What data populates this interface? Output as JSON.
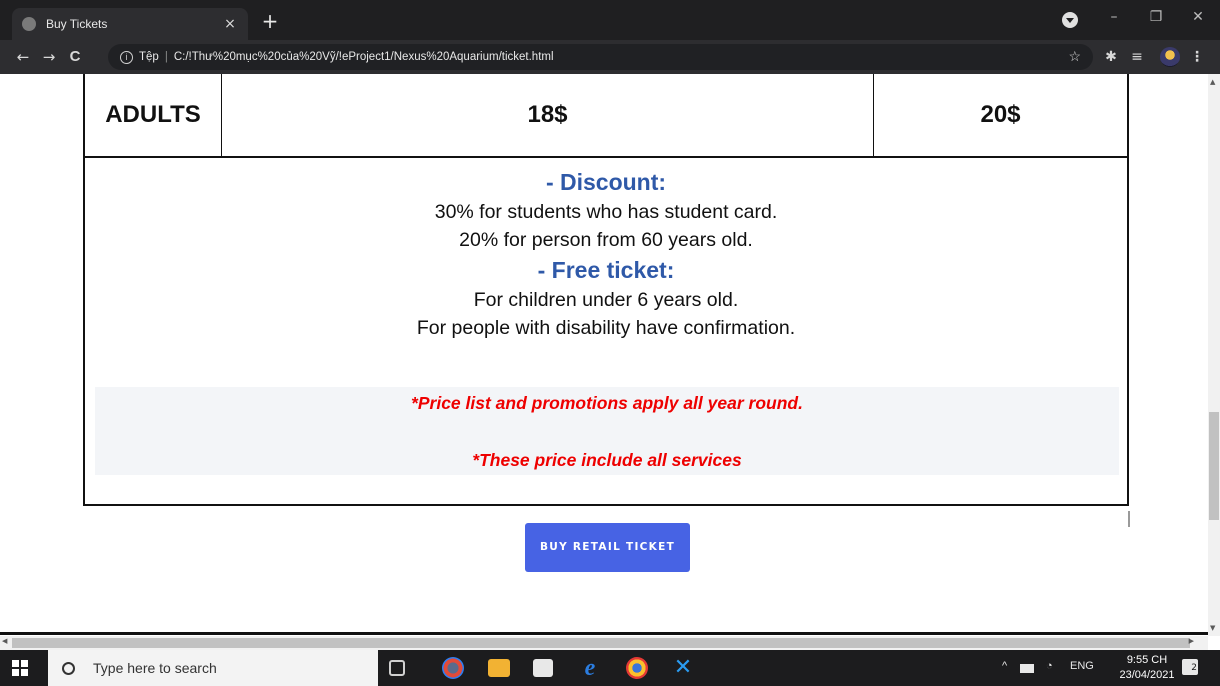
{
  "browser": {
    "tab_title": "Buy Tickets",
    "tab_close": "×",
    "new_tab": "+",
    "url_scheme": "Tệp",
    "url_separator": "|",
    "url_path": "C:/!Thư%20mục%20của%20Vỹ/!eProject1/Nexus%20Aquarium/ticket.html",
    "info_glyph": "i",
    "back": "←",
    "forward": "→",
    "reload": "C",
    "bookmark_star": "☆",
    "minimize": "–",
    "restore": "❐",
    "close": "✕",
    "menu": "⋮",
    "extensions": "✱",
    "reading_list": "≡"
  },
  "page": {
    "price_row": {
      "label": "ADULTS",
      "price_1": "18$",
      "price_2": "20$"
    },
    "discount_heading": "- Discount:",
    "discount_lines": [
      "30% for students who has student card.",
      "20% for person from 60 years old."
    ],
    "free_heading": "- Free ticket:",
    "free_lines": [
      "For children under 6 years old.",
      "For people with disability have confirmation."
    ],
    "notes": [
      "*Price list and promotions apply all year round.",
      "*These price include all services"
    ],
    "buy_button": "BUY RETAIL TICKET"
  },
  "taskbar": {
    "search_placeholder": "Type here to search",
    "language": "ENG",
    "time": "9:55 CH",
    "date": "23/04/2021",
    "notification_count": "2",
    "tray_chevron": "^"
  },
  "colors": {
    "heading_blue": "#2f59a8",
    "note_red": "#ee0000",
    "button_blue": "#4763e4"
  }
}
